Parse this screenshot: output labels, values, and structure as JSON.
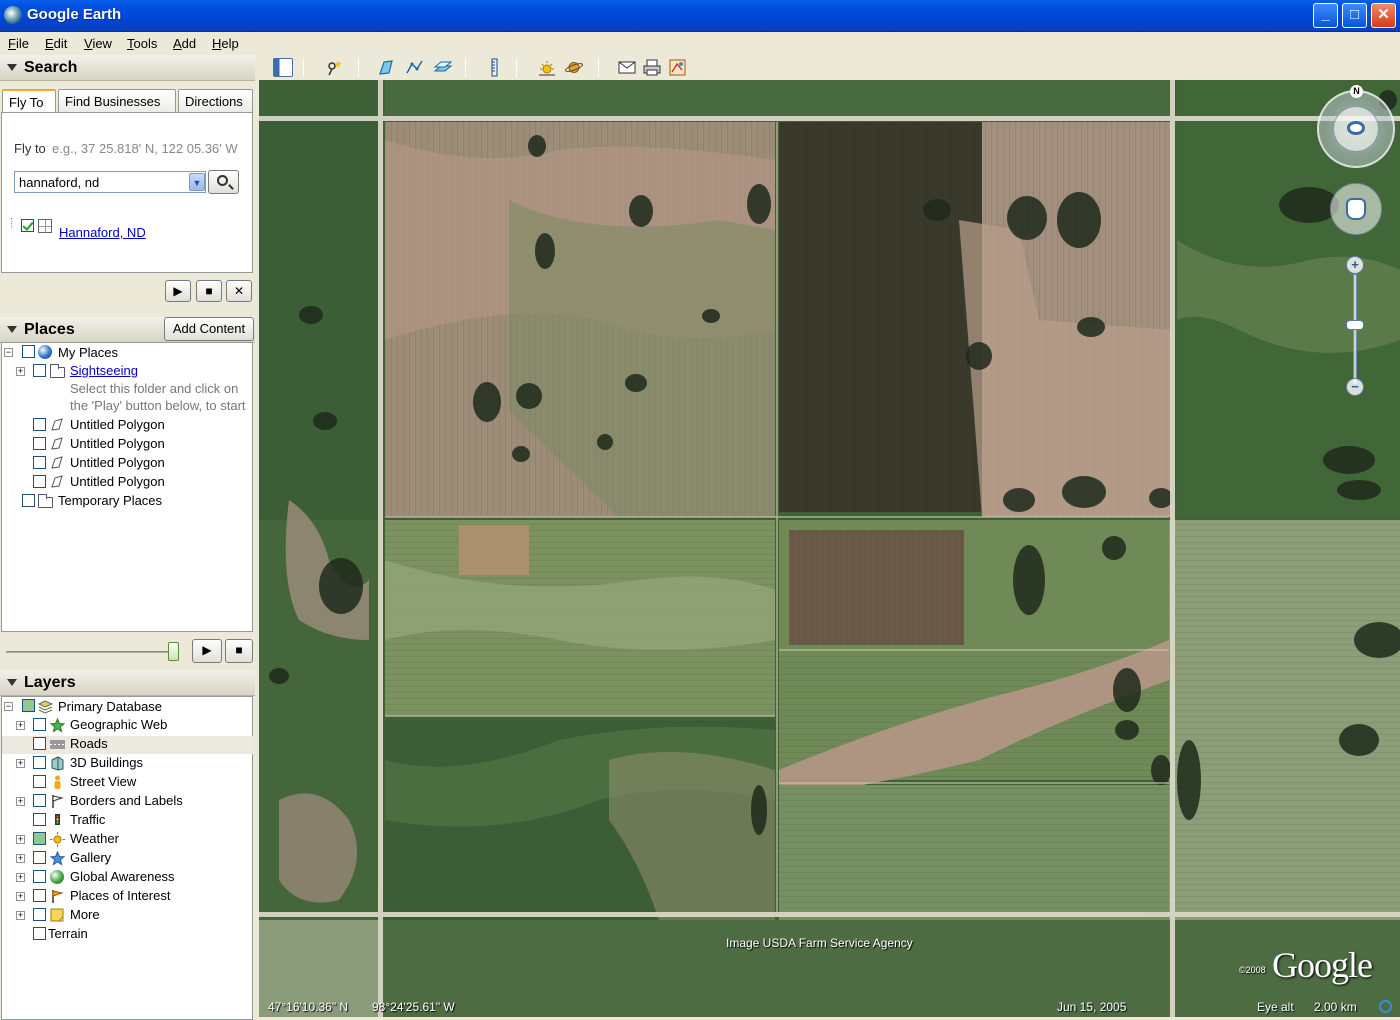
{
  "window": {
    "title": "Google Earth",
    "min": "_",
    "max": "□",
    "close": "✕"
  },
  "menu": [
    "File",
    "Edit",
    "View",
    "Tools",
    "Add",
    "Help"
  ],
  "search": {
    "title": "Search",
    "tabs": [
      "Fly To",
      "Find Businesses",
      "Directions"
    ],
    "flyto_label": "Fly to",
    "flyto_hint": "e.g., 37 25.818' N, 122 05.36' W",
    "input_value": "hannaford, nd",
    "result": "Hannaford, ND"
  },
  "places": {
    "title": "Places",
    "add_content": "Add Content",
    "items": [
      "My Places",
      "Sightseeing",
      "Select this folder and click on",
      "the 'Play' button below, to start",
      "Untitled Polygon",
      "Untitled Polygon",
      "Untitled Polygon",
      "Untitled Polygon",
      "Temporary Places"
    ],
    "tour_position": 0.98
  },
  "layers": {
    "title": "Layers",
    "items": [
      "Primary Database",
      "Geographic Web",
      "Roads",
      "3D Buildings",
      "Street View",
      "Borders and Labels",
      "Traffic",
      "Weather",
      "Gallery",
      "Global Awareness",
      "Places of Interest",
      "More",
      "Terrain"
    ]
  },
  "map": {
    "attribution": "Image USDA Farm Service Agency",
    "latitude": "47°16'10.36\" N",
    "longitude": "98°24'25.61\" W",
    "imagery_date": "Jun 15, 2005",
    "eye_alt_label": "Eye alt",
    "eye_alt_value": "2.00 km",
    "copyright": "©2008",
    "logo": "Google",
    "compass_n": "N",
    "zoom_in": "+",
    "zoom_out": "−"
  },
  "colors": {
    "titlebar": "#0046d5",
    "link": "#0000cc",
    "field_green": "#4f6f45",
    "field_pink": "#b99e8c",
    "road": "#d9d6c8"
  }
}
